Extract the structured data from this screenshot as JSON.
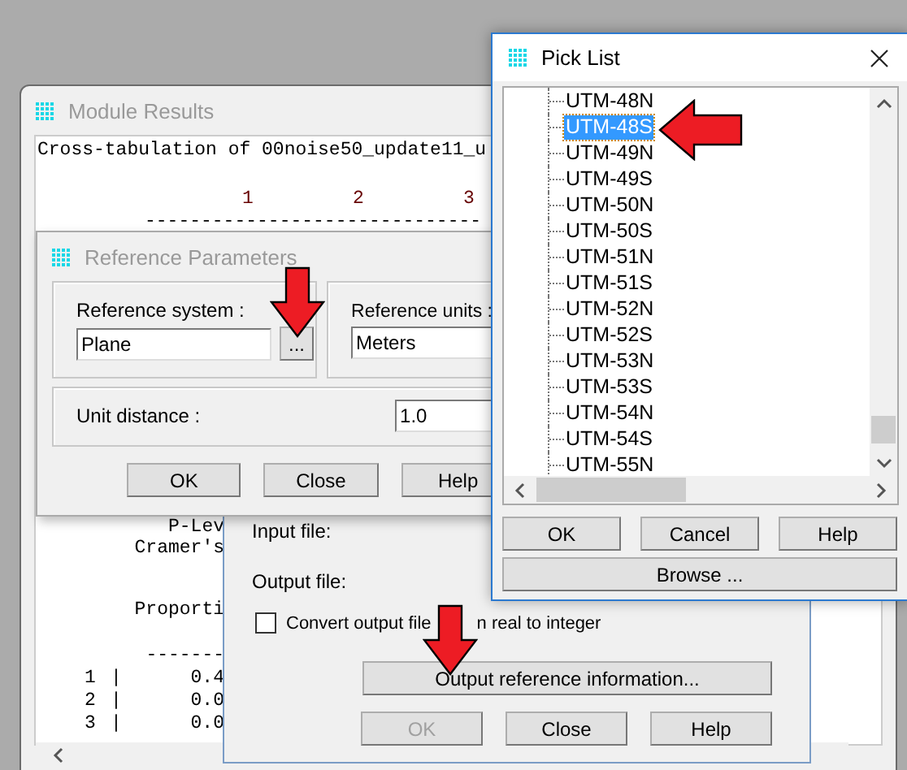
{
  "module_results_window": {
    "title": "Module Results",
    "output": {
      "title_line": "Cross-tabulation of 00noise50_update11_u",
      "column_headers": [
        "1",
        "2",
        "3"
      ],
      "header_rule": "------------------------------",
      "stats_lines": [
        "P-Lev",
        "Cramer's",
        "Proporti"
      ],
      "table_rule": "-------",
      "rows": [
        {
          "index": "1",
          "separator": "|",
          "value": "0.4"
        },
        {
          "index": "2",
          "separator": "|",
          "value": "0.0"
        },
        {
          "index": "3",
          "separator": "|",
          "value": "0.0"
        }
      ]
    }
  },
  "conversion_dialog": {
    "input_file_label": "Input file:",
    "output_file_label": "Output file:",
    "convert_checkbox": {
      "label_parts": [
        "Convert output file",
        "n real to integer"
      ],
      "checked": false
    },
    "reference_button": "Output reference information...",
    "buttons": [
      {
        "label": "OK",
        "disabled": true
      },
      {
        "label": "Close",
        "disabled": false
      },
      {
        "label": "Help",
        "disabled": false
      }
    ]
  },
  "reference_parameters_dialog": {
    "title": "Reference Parameters",
    "reference_system": {
      "label": "Reference system :",
      "value": "Plane",
      "browse_button": "..."
    },
    "reference_units": {
      "label": "Reference units :",
      "value": "Meters"
    },
    "unit_distance": {
      "label": "Unit distance :",
      "value": "1.0"
    },
    "buttons": [
      "OK",
      "Close",
      "Help"
    ]
  },
  "pick_list_dialog": {
    "title": "Pick List",
    "items": [
      {
        "label": "UTM-48N",
        "selected": false
      },
      {
        "label": "UTM-48S",
        "selected": true
      },
      {
        "label": "UTM-49N",
        "selected": false
      },
      {
        "label": "UTM-49S",
        "selected": false
      },
      {
        "label": "UTM-50N",
        "selected": false
      },
      {
        "label": "UTM-50S",
        "selected": false
      },
      {
        "label": "UTM-51N",
        "selected": false
      },
      {
        "label": "UTM-51S",
        "selected": false
      },
      {
        "label": "UTM-52N",
        "selected": false
      },
      {
        "label": "UTM-52S",
        "selected": false
      },
      {
        "label": "UTM-53N",
        "selected": false
      },
      {
        "label": "UTM-53S",
        "selected": false
      },
      {
        "label": "UTM-54N",
        "selected": false
      },
      {
        "label": "UTM-54S",
        "selected": false
      },
      {
        "label": "UTM-55N",
        "selected": false
      }
    ],
    "buttons": [
      "OK",
      "Cancel",
      "Help"
    ],
    "browse_button": "Browse ..."
  }
}
